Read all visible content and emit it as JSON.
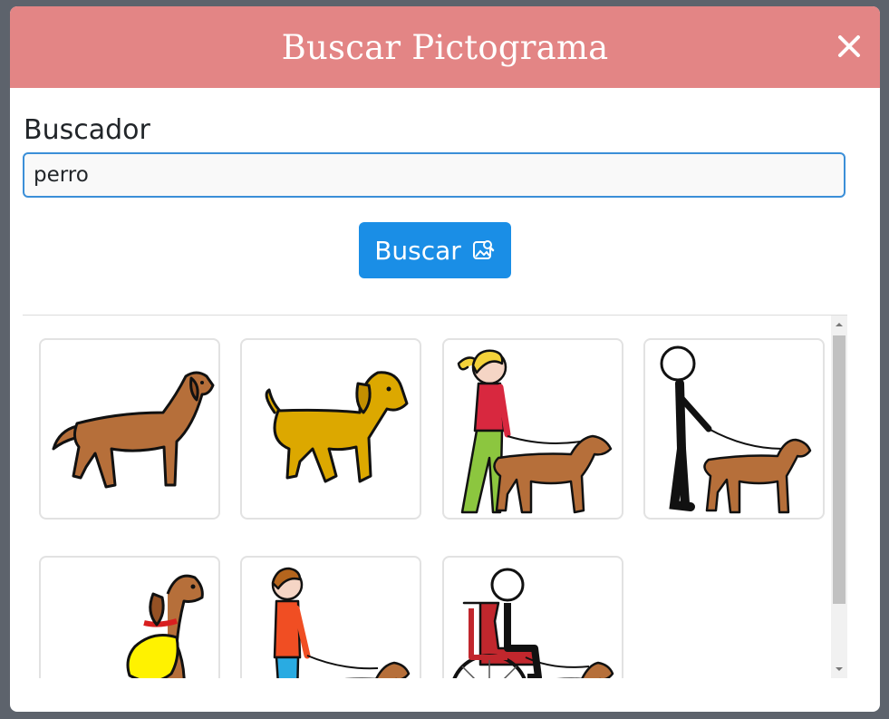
{
  "modal": {
    "title": "Buscar Pictograma",
    "header_color": "#e38585"
  },
  "search": {
    "label": "Buscador",
    "value": "perro",
    "button_label": "Buscar"
  },
  "results": {
    "items": [
      {
        "icon": "dog-standing-icon"
      },
      {
        "icon": "yellow-dog-icon"
      },
      {
        "icon": "girl-walking-dog-icon"
      },
      {
        "icon": "person-walking-dog-icon"
      },
      {
        "icon": "guide-dog-harness-icon"
      },
      {
        "icon": "boy-walking-dog-icon"
      },
      {
        "icon": "wheelchair-user-with-dog-icon"
      }
    ]
  },
  "colors": {
    "accent": "#1a8ee6",
    "dog_brown": "#b66f3a",
    "dog_yellow": "#dca800"
  }
}
